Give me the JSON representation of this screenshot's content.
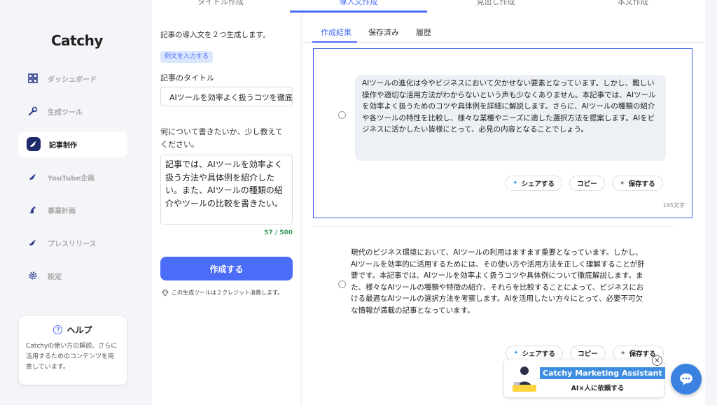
{
  "steps": [
    "タイトル作成",
    "導入文作成",
    "見出し作成",
    "本文作成"
  ],
  "brand": "Catchy",
  "sidebar": {
    "items": [
      {
        "label": "ダッシュボード",
        "icon": "grid-icon"
      },
      {
        "label": "生成ツール",
        "icon": "wrench-icon"
      },
      {
        "label": "記事制作",
        "icon": "bird-icon"
      },
      {
        "label": "YouTube企画",
        "icon": "bird-icon"
      },
      {
        "label": "事業計画",
        "icon": "horse-icon"
      },
      {
        "label": "プレスリリース",
        "icon": "bird-icon"
      },
      {
        "label": "設定",
        "icon": "gear-icon"
      }
    ],
    "active_index": 2
  },
  "help": {
    "title": "ヘルプ",
    "text": "Catchyの使い方の解説、さらに活用するためのコンテンツを用意しています。"
  },
  "form": {
    "intro": "記事の導入文を２つ生成します。",
    "example_button": "例文を入力する",
    "title_label": "記事のタイトル",
    "title_value": "AIツールを効率よく扱うコツを徹底解説",
    "about_label": "何について書きたいか、少し教えてください。",
    "about_value": "記事では、AIツールを効率よく扱う方法や具体例を紹介したい。また、AIツールの種類の紹介やツールの比較を書きたい。",
    "counter": "57 / 500",
    "create_button": "作成する",
    "credit_note": "この生成ツールは２クレジット消費します。"
  },
  "results": {
    "tabs": [
      "作成結果",
      "保存済み",
      "履歴"
    ],
    "active_tab": 0,
    "items": [
      {
        "text": "AIツールの進化は今やビジネスにおいて欠かせない要素となっています。しかし、難しい操作や適切な活用方法がわからないという声も少なくありません。本記事では、AIツールを効率よく扱うためのコツや具体例を詳細に解説します。さらに、AIツールの種類の紹介や各ツールの特性を比較し、様々な業種やニーズに適した選択方法を提案します。AIをビジネスに活かしたい皆様にとって、必見の内容となることでしょう。",
        "char_count": "195文字"
      },
      {
        "text": "現代のビジネス環境において、AIツールの利用はますます重要となっています。しかし、AIツールを効率的に活用するためには、その使い方や活用方法を正しく理解することが肝要です。本記事では、AIツールを効率よく扱うコツや具体例について徹底解説します。また、様々なAIツールの種類や特徴の紹介、それらを比較することによって、ビジネスにおける最適なAIツールの選択方法を考察します。AIを活用したい方々にとって、必要不可欠な情報が満載の記事となっています。"
      }
    ],
    "actions": {
      "share": "シェアする",
      "copy": "コピー",
      "save": "保存する"
    }
  },
  "assistant": {
    "title": "Catchy Marketing Assistant",
    "subtitle": "AI×人に依頼する"
  },
  "colors": {
    "accent": "#4a6cf7",
    "sidebar_active_icon": "#1f2a6b",
    "counter": "#3a9b5d"
  }
}
